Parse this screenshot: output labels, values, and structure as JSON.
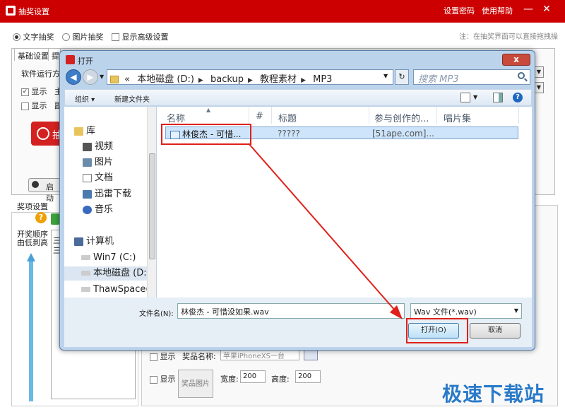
{
  "app": {
    "title": "抽奖设置",
    "menu_password": "设置密码",
    "menu_help": "使用帮助",
    "minimize": "—",
    "close": "✕"
  },
  "modes": {
    "text_draw": "文字抽奖",
    "image_draw": "图片抽奖",
    "show_advanced": "显示高级设置",
    "hint": "注：在抽奖界面可以直接拖拽操"
  },
  "basic": {
    "tab_basic": "基础设置",
    "tab_other": "提",
    "run_mode_label": "软件运行方",
    "show1": "显示",
    "show1_suffix": "主",
    "show2": "显示",
    "show2_suffix": "副",
    "draw_btn": "抽",
    "start_btn": "启动"
  },
  "prize": {
    "section_label": "奖项设置",
    "help": "?",
    "order_line1": "开奖顺序",
    "order_line2": "由低到高",
    "list_items": [
      "三",
      "三"
    ],
    "show_label": "显示",
    "prize_name_label": "奖品名称:",
    "prize_name_value": "苹果iPhoneXS一台",
    "show_label2": "显示",
    "prize_pic_btn": "奖品图片",
    "width_label": "宽度:",
    "width_value": "200",
    "height_label": "高度:",
    "height_value": "200"
  },
  "dialog": {
    "title": "打开",
    "close": "x",
    "back": "◀",
    "forward": "▶",
    "address": [
      "«",
      "本地磁盘 (D:)",
      "backup",
      "教程素材",
      "MP3"
    ],
    "refresh": "↻",
    "search_placeholder": "搜索 MP3",
    "toolbar": {
      "organize": "组织 ▾",
      "new_folder": "新建文件夹"
    },
    "nav": [
      {
        "label": "库",
        "icon": "library-icon"
      },
      {
        "label": "视频",
        "icon": "video-icon"
      },
      {
        "label": "图片",
        "icon": "picture-icon"
      },
      {
        "label": "文档",
        "icon": "document-icon"
      },
      {
        "label": "迅雷下载",
        "icon": "thunder-icon"
      },
      {
        "label": "音乐",
        "icon": "music-icon"
      },
      {
        "label": "计算机",
        "icon": "computer-icon"
      },
      {
        "label": "Win7 (C:)",
        "icon": "drive-icon"
      },
      {
        "label": "本地磁盘 (D:",
        "icon": "drive-icon"
      },
      {
        "label": "ThawSpace(",
        "icon": "drive-icon"
      }
    ],
    "columns": [
      "名称",
      "#",
      "标题",
      "参与创作的...",
      "唱片集"
    ],
    "file": {
      "name": "林俊杰 - 可惜...",
      "title": "?????",
      "artist": "[51ape.com]..."
    },
    "filename_label": "文件名(N):",
    "filename_value": "林俊杰 - 可惜没如果.wav",
    "filetype_value": "Wav  文件(*.wav)",
    "open_btn": "打开(O)",
    "cancel_btn": "取消"
  },
  "watermark": "极速下载站",
  "colors": {
    "title_red": "#cc0000",
    "highlight_red": "#e0201a",
    "accent_blue": "#3d7cc6"
  }
}
